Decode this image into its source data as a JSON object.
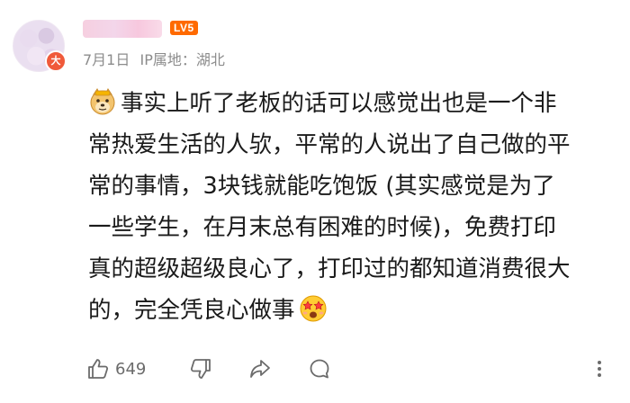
{
  "user": {
    "avatar_badge": "大",
    "level_badge": "LV5"
  },
  "meta": {
    "date": "7月1日",
    "ip_location": "IP属地：湖北"
  },
  "content": {
    "lines": [
      "事实上听了老板的话可以感觉出也是一个非",
      "常热爱生活的人欤，平常的人说出了自己做的平",
      "常的事情，3块钱就能吃饱饭 (其实感觉是为了",
      "一些学生，在月末总有困难的时候)，免费打印",
      "真的超级超级良心了，打印过的都知道消费很大",
      "的，完全凭良心做事"
    ],
    "leading_emoji": "doge-emoji",
    "trailing_emoji": "star-eyes-emoji"
  },
  "actions": {
    "like_count": "649",
    "icons": [
      "thumbs-up-icon",
      "thumbs-down-icon",
      "share-icon",
      "comment-icon",
      "more-icon"
    ]
  }
}
